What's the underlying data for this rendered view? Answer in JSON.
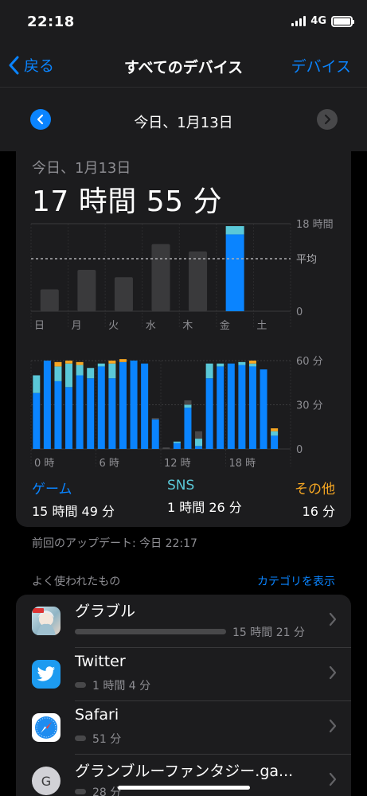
{
  "status": {
    "time": "22:18",
    "network": "4G"
  },
  "nav": {
    "back_label": "戻る",
    "title": "すべてのデバイス",
    "right_label": "デバイス"
  },
  "date_nav": {
    "label": "今日、1月13日"
  },
  "summary": {
    "date": "今日、1月13日",
    "total": "17 時間 55 分"
  },
  "chart_data": [
    {
      "type": "bar",
      "categories": [
        "日",
        "月",
        "火",
        "水",
        "木",
        "金",
        "土"
      ],
      "values": [
        4.5,
        8.5,
        7.0,
        13.8,
        12.3,
        17.9,
        0
      ],
      "highlight_index": 5,
      "average": 10.8,
      "average_label": "平均",
      "ylim": [
        0,
        18
      ],
      "yticks": [
        {
          "v": 18,
          "label": "18 時間"
        },
        {
          "v": 0,
          "label": "0"
        }
      ],
      "colors": {
        "normal": "#3a3a3c",
        "game": "#0a84ff",
        "sns": "#5ac8d8"
      },
      "highlight_breakdown": {
        "game": 15.8,
        "sns": 1.4,
        "other": 0.3
      }
    },
    {
      "type": "bar",
      "stacked": true,
      "x": [
        0,
        1,
        2,
        3,
        4,
        5,
        6,
        7,
        8,
        9,
        10,
        11,
        12,
        13,
        14,
        15,
        16,
        17,
        18,
        19,
        20,
        21,
        22
      ],
      "series": [
        {
          "name": "ゲーム",
          "color": "#0a84ff",
          "values": [
            38,
            60,
            46,
            42,
            50,
            48,
            56,
            48,
            59,
            60,
            58,
            20,
            0,
            4,
            28,
            2,
            48,
            56,
            58,
            57,
            56,
            54,
            9
          ]
        },
        {
          "name": "SNS",
          "color": "#5ac8d8",
          "values": [
            12,
            0,
            10,
            16,
            7,
            7,
            2,
            10,
            0,
            0,
            0,
            0,
            0,
            1,
            2,
            5,
            10,
            2,
            0,
            2,
            2,
            0,
            3
          ]
        },
        {
          "name": "その他",
          "color": "#f5a623",
          "values": [
            0,
            0,
            3,
            2,
            2,
            0,
            0,
            2,
            2,
            0,
            0,
            0,
            0,
            0,
            0,
            0,
            0,
            0,
            0,
            0,
            2,
            0,
            2
          ]
        },
        {
          "color": "#48484a",
          "values": [
            0,
            0,
            0,
            0,
            0,
            0,
            0,
            0,
            0,
            0,
            0,
            1,
            1,
            0,
            3,
            5,
            0,
            0,
            0,
            0,
            0,
            0,
            0
          ]
        }
      ],
      "ylim": [
        0,
        60
      ],
      "yticks": [
        {
          "v": 60,
          "label": "60 分"
        },
        {
          "v": 30,
          "label": "30 分"
        },
        {
          "v": 0,
          "label": "0"
        }
      ],
      "xticks": [
        {
          "h": 0,
          "label": "0 時"
        },
        {
          "h": 6,
          "label": "6 時"
        },
        {
          "h": 12,
          "label": "12 時"
        },
        {
          "h": 18,
          "label": "18 時"
        }
      ]
    }
  ],
  "legend": {
    "game": {
      "label": "ゲーム",
      "value": "15 時間 49 分"
    },
    "sns": {
      "label": "SNS",
      "value": "1 時間 26 分"
    },
    "other": {
      "label": "その他",
      "value": "16 分"
    }
  },
  "updated": "前回のアップデート: 今日 22:17",
  "section": {
    "title": "よく使われたもの",
    "link": "カテゴリを表示"
  },
  "apps": [
    {
      "name": "グラブル",
      "time": "15 時間 21 分",
      "fraction": 1.0,
      "icon": "granblue-icon"
    },
    {
      "name": "Twitter",
      "time": "1 時間 4 分",
      "fraction": 0.07,
      "icon": "twitter-icon"
    },
    {
      "name": "Safari",
      "time": "51 分",
      "fraction": 0.055,
      "icon": "safari-icon"
    },
    {
      "name": "グランブルーファンタジー.ga...",
      "time": "28 分",
      "fraction": 0.03,
      "icon": "generic-g-icon",
      "icon_letter": "G"
    }
  ]
}
